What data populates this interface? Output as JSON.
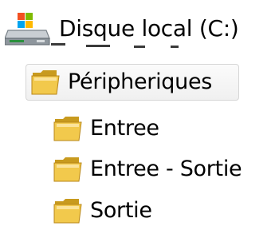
{
  "explorer_tree": {
    "drive": {
      "label": "Disque local (C:)",
      "icon": "local-drive-windows-icon"
    },
    "selected_folder": {
      "label": "Péripheriques",
      "icon": "folder-icon"
    },
    "subfolders": [
      {
        "label": "Entree",
        "icon": "folder-icon"
      },
      {
        "label": "Entree - Sortie",
        "icon": "folder-icon"
      },
      {
        "label": "Sortie",
        "icon": "folder-icon"
      }
    ]
  },
  "colors": {
    "selection_border": "#d6d6d6",
    "selection_background": "#f4f4f4",
    "folder_yellow": "#f2c94c",
    "folder_dark": "#c89a1e"
  }
}
